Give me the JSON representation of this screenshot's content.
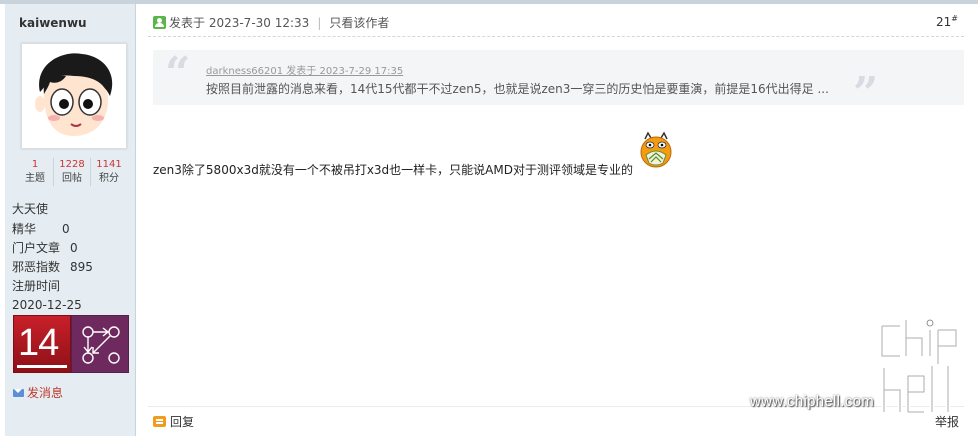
{
  "user": {
    "username": "kaiwenwu",
    "stats": [
      {
        "value": "1",
        "label": "主题"
      },
      {
        "value": "1228",
        "label": "回帖"
      },
      {
        "value": "1141",
        "label": "积分"
      }
    ],
    "rank": "大天使",
    "info": [
      {
        "key": "精华",
        "value": "0"
      },
      {
        "key": "门户文章",
        "value": "0"
      },
      {
        "key": "邪恶指数",
        "value": "895"
      },
      {
        "key": "注册时间",
        "value": "2020-12-25"
      }
    ],
    "medal_number": "14",
    "send_message": "发消息"
  },
  "post": {
    "posted_at": "发表于 2023-7-30 12:33",
    "only_author": "只看该作者",
    "floor": "21",
    "floor_mark": "#",
    "quote": {
      "meta": "darkness66201 发表于 2023-7-29 17:35",
      "text": "按照目前泄露的消息来看，14代15代都干不过zen5，也就是说zen3一穿三的历史怕是要重演，前提是16代出得足 ..."
    },
    "body": "zen3除了5800x3d就没有一个不被吊打x3d也一样卡，只能说AMD对于测评领域是专业的",
    "reply": "回复",
    "report": "举报"
  },
  "watermark": {
    "url": "www.chiphell.com"
  },
  "colors": {
    "sidebar_bg": "#e5edf2",
    "stat_number": "#cc3333",
    "send_message": "#c0392b",
    "medal_red": "#c8202a",
    "medal_purple": "#6e2a5e"
  }
}
